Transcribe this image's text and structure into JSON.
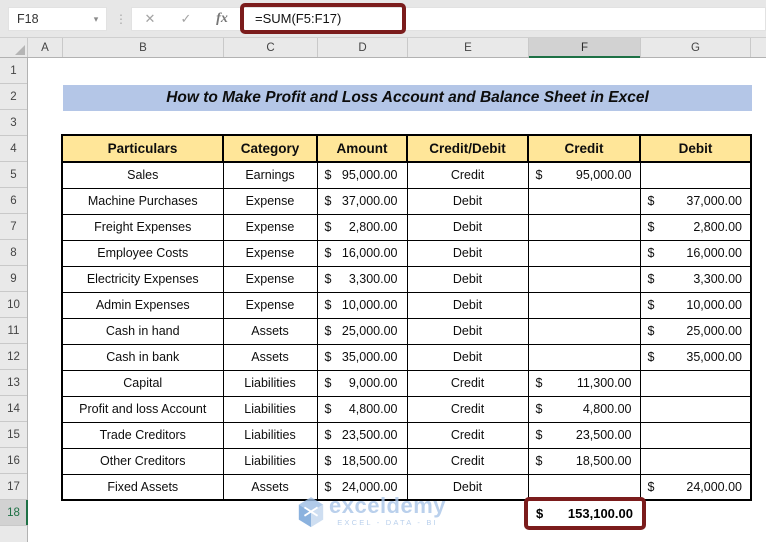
{
  "topbar": {
    "name_box": "F18",
    "dropdown_glyph": "▾",
    "separator_glyph": "⋮",
    "cancel_glyph": "✕",
    "confirm_glyph": "✓",
    "fx_glyph": "fx",
    "formula": "=SUM(F5:F17)"
  },
  "grid": {
    "col_headers": [
      "A",
      "B",
      "C",
      "D",
      "E",
      "F",
      "G"
    ],
    "selected_col": "F",
    "row_numbers": [
      "1",
      "2",
      "3",
      "4",
      "5",
      "6",
      "7",
      "8",
      "9",
      "10",
      "11",
      "12",
      "13",
      "14",
      "15",
      "16",
      "17",
      "18"
    ],
    "selected_row": "18"
  },
  "sheet": {
    "title": "How to Make Profit and Loss Account and Balance Sheet in Excel"
  },
  "table": {
    "currency": "$",
    "headers": [
      "Particulars",
      "Category",
      "Amount",
      "Credit/Debit",
      "Credit",
      "Debit"
    ],
    "rows": [
      {
        "p": "Sales",
        "c": "Earnings",
        "a": "95,000.00",
        "cd": "Credit",
        "cr": "95,000.00",
        "db": ""
      },
      {
        "p": "Machine Purchases",
        "c": "Expense",
        "a": "37,000.00",
        "cd": "Debit",
        "cr": "",
        "db": "37,000.00"
      },
      {
        "p": "Freight Expenses",
        "c": "Expense",
        "a": "2,800.00",
        "cd": "Debit",
        "cr": "",
        "db": "2,800.00"
      },
      {
        "p": "Employee Costs",
        "c": "Expense",
        "a": "16,000.00",
        "cd": "Debit",
        "cr": "",
        "db": "16,000.00"
      },
      {
        "p": "Electricity Expenses",
        "c": "Expense",
        "a": "3,300.00",
        "cd": "Debit",
        "cr": "",
        "db": "3,300.00"
      },
      {
        "p": "Admin Expenses",
        "c": "Expense",
        "a": "10,000.00",
        "cd": "Debit",
        "cr": "",
        "db": "10,000.00"
      },
      {
        "p": "Cash in hand",
        "c": "Assets",
        "a": "25,000.00",
        "cd": "Debit",
        "cr": "",
        "db": "25,000.00"
      },
      {
        "p": "Cash in bank",
        "c": "Assets",
        "a": "35,000.00",
        "cd": "Debit",
        "cr": "",
        "db": "35,000.00"
      },
      {
        "p": "Capital",
        "c": "Liabilities",
        "a": "9,000.00",
        "cd": "Credit",
        "cr": "11,300.00",
        "db": ""
      },
      {
        "p": "Profit and loss Account",
        "c": "Liabilities",
        "a": "4,800.00",
        "cd": "Credit",
        "cr": "4,800.00",
        "db": ""
      },
      {
        "p": "Trade Creditors",
        "c": "Liabilities",
        "a": "23,500.00",
        "cd": "Credit",
        "cr": "23,500.00",
        "db": ""
      },
      {
        "p": "Other Creditors",
        "c": "Liabilities",
        "a": "18,500.00",
        "cd": "Credit",
        "cr": "18,500.00",
        "db": ""
      },
      {
        "p": "Fixed Assets",
        "c": "Assets",
        "a": "24,000.00",
        "cd": "Debit",
        "cr": "",
        "db": "24,000.00"
      }
    ],
    "total": "153,100.00"
  },
  "watermark": {
    "brand": "exceldemy",
    "tagline": "EXCEL - DATA - BI"
  },
  "colors": {
    "title_bg": "#B4C6E7",
    "header_bg": "#FFE699",
    "annotation_red": "#7B1C1C",
    "excel_green": "#1E7145",
    "selected_header_bg": "#D2D2D2",
    "watermark_blue": "#A9C5E8"
  }
}
